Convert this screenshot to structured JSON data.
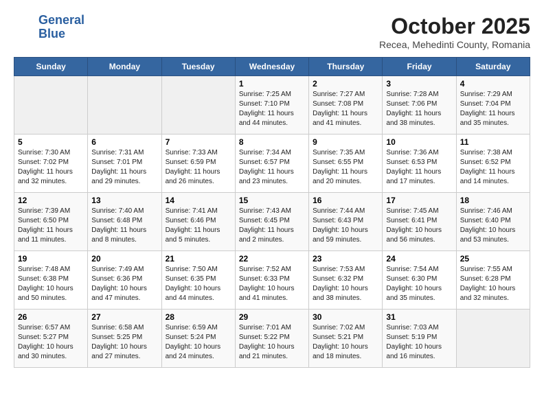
{
  "header": {
    "logo_line1": "General",
    "logo_line2": "Blue",
    "month": "October 2025",
    "location": "Recea, Mehedinti County, Romania"
  },
  "weekdays": [
    "Sunday",
    "Monday",
    "Tuesday",
    "Wednesday",
    "Thursday",
    "Friday",
    "Saturday"
  ],
  "weeks": [
    [
      {
        "day": "",
        "info": ""
      },
      {
        "day": "",
        "info": ""
      },
      {
        "day": "",
        "info": ""
      },
      {
        "day": "1",
        "info": "Sunrise: 7:25 AM\nSunset: 7:10 PM\nDaylight: 11 hours and 44 minutes."
      },
      {
        "day": "2",
        "info": "Sunrise: 7:27 AM\nSunset: 7:08 PM\nDaylight: 11 hours and 41 minutes."
      },
      {
        "day": "3",
        "info": "Sunrise: 7:28 AM\nSunset: 7:06 PM\nDaylight: 11 hours and 38 minutes."
      },
      {
        "day": "4",
        "info": "Sunrise: 7:29 AM\nSunset: 7:04 PM\nDaylight: 11 hours and 35 minutes."
      }
    ],
    [
      {
        "day": "5",
        "info": "Sunrise: 7:30 AM\nSunset: 7:02 PM\nDaylight: 11 hours and 32 minutes."
      },
      {
        "day": "6",
        "info": "Sunrise: 7:31 AM\nSunset: 7:01 PM\nDaylight: 11 hours and 29 minutes."
      },
      {
        "day": "7",
        "info": "Sunrise: 7:33 AM\nSunset: 6:59 PM\nDaylight: 11 hours and 26 minutes."
      },
      {
        "day": "8",
        "info": "Sunrise: 7:34 AM\nSunset: 6:57 PM\nDaylight: 11 hours and 23 minutes."
      },
      {
        "day": "9",
        "info": "Sunrise: 7:35 AM\nSunset: 6:55 PM\nDaylight: 11 hours and 20 minutes."
      },
      {
        "day": "10",
        "info": "Sunrise: 7:36 AM\nSunset: 6:53 PM\nDaylight: 11 hours and 17 minutes."
      },
      {
        "day": "11",
        "info": "Sunrise: 7:38 AM\nSunset: 6:52 PM\nDaylight: 11 hours and 14 minutes."
      }
    ],
    [
      {
        "day": "12",
        "info": "Sunrise: 7:39 AM\nSunset: 6:50 PM\nDaylight: 11 hours and 11 minutes."
      },
      {
        "day": "13",
        "info": "Sunrise: 7:40 AM\nSunset: 6:48 PM\nDaylight: 11 hours and 8 minutes."
      },
      {
        "day": "14",
        "info": "Sunrise: 7:41 AM\nSunset: 6:46 PM\nDaylight: 11 hours and 5 minutes."
      },
      {
        "day": "15",
        "info": "Sunrise: 7:43 AM\nSunset: 6:45 PM\nDaylight: 11 hours and 2 minutes."
      },
      {
        "day": "16",
        "info": "Sunrise: 7:44 AM\nSunset: 6:43 PM\nDaylight: 10 hours and 59 minutes."
      },
      {
        "day": "17",
        "info": "Sunrise: 7:45 AM\nSunset: 6:41 PM\nDaylight: 10 hours and 56 minutes."
      },
      {
        "day": "18",
        "info": "Sunrise: 7:46 AM\nSunset: 6:40 PM\nDaylight: 10 hours and 53 minutes."
      }
    ],
    [
      {
        "day": "19",
        "info": "Sunrise: 7:48 AM\nSunset: 6:38 PM\nDaylight: 10 hours and 50 minutes."
      },
      {
        "day": "20",
        "info": "Sunrise: 7:49 AM\nSunset: 6:36 PM\nDaylight: 10 hours and 47 minutes."
      },
      {
        "day": "21",
        "info": "Sunrise: 7:50 AM\nSunset: 6:35 PM\nDaylight: 10 hours and 44 minutes."
      },
      {
        "day": "22",
        "info": "Sunrise: 7:52 AM\nSunset: 6:33 PM\nDaylight: 10 hours and 41 minutes."
      },
      {
        "day": "23",
        "info": "Sunrise: 7:53 AM\nSunset: 6:32 PM\nDaylight: 10 hours and 38 minutes."
      },
      {
        "day": "24",
        "info": "Sunrise: 7:54 AM\nSunset: 6:30 PM\nDaylight: 10 hours and 35 minutes."
      },
      {
        "day": "25",
        "info": "Sunrise: 7:55 AM\nSunset: 6:28 PM\nDaylight: 10 hours and 32 minutes."
      }
    ],
    [
      {
        "day": "26",
        "info": "Sunrise: 6:57 AM\nSunset: 5:27 PM\nDaylight: 10 hours and 30 minutes."
      },
      {
        "day": "27",
        "info": "Sunrise: 6:58 AM\nSunset: 5:25 PM\nDaylight: 10 hours and 27 minutes."
      },
      {
        "day": "28",
        "info": "Sunrise: 6:59 AM\nSunset: 5:24 PM\nDaylight: 10 hours and 24 minutes."
      },
      {
        "day": "29",
        "info": "Sunrise: 7:01 AM\nSunset: 5:22 PM\nDaylight: 10 hours and 21 minutes."
      },
      {
        "day": "30",
        "info": "Sunrise: 7:02 AM\nSunset: 5:21 PM\nDaylight: 10 hours and 18 minutes."
      },
      {
        "day": "31",
        "info": "Sunrise: 7:03 AM\nSunset: 5:19 PM\nDaylight: 10 hours and 16 minutes."
      },
      {
        "day": "",
        "info": ""
      }
    ]
  ]
}
